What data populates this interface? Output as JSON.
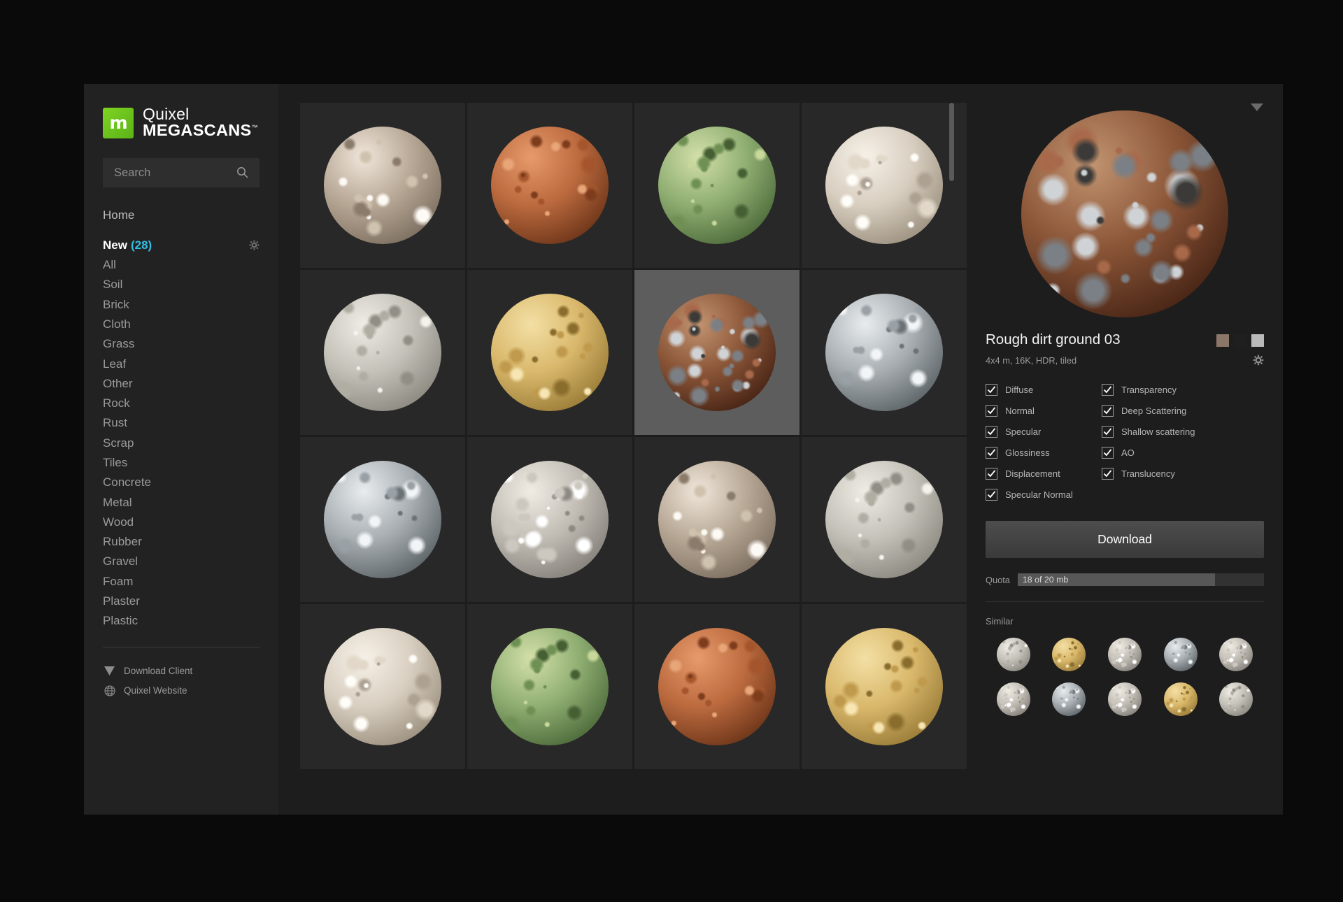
{
  "brand": {
    "name_line1": "Quixel",
    "name_line2": "MEGASCANS",
    "trademark": "™",
    "logo_letter": "m",
    "logo_color": "#7ed321"
  },
  "search": {
    "placeholder": "Search",
    "value": "",
    "icon": "search-icon"
  },
  "sidebar": {
    "home_label": "Home",
    "items": [
      {
        "label": "New",
        "count": "(28)",
        "active": true,
        "has_gear": true
      },
      {
        "label": "All",
        "active": false
      },
      {
        "label": "Soil",
        "active": false
      },
      {
        "label": "Brick",
        "active": false
      },
      {
        "label": "Cloth",
        "active": false
      },
      {
        "label": "Grass",
        "active": false
      },
      {
        "label": "Leaf",
        "active": false
      },
      {
        "label": "Other",
        "active": false
      },
      {
        "label": "Rock",
        "active": false
      },
      {
        "label": "Rust",
        "active": false
      },
      {
        "label": "Scrap",
        "active": false
      },
      {
        "label": "Tiles",
        "active": false
      },
      {
        "label": "Concrete",
        "active": false
      },
      {
        "label": "Metal",
        "active": false
      },
      {
        "label": "Wood",
        "active": false
      },
      {
        "label": "Rubber",
        "active": false
      },
      {
        "label": "Gravel",
        "active": false
      },
      {
        "label": "Foam",
        "active": false
      },
      {
        "label": "Plaster",
        "active": false
      },
      {
        "label": "Plastic",
        "active": false
      }
    ],
    "footer": [
      {
        "label": "Download Client",
        "icon": "download-triangle-icon"
      },
      {
        "label": "Quixel Website",
        "icon": "globe-icon"
      }
    ],
    "accent_color": "#35bde4"
  },
  "grid": {
    "scroll_thumb_percent": 13,
    "items": [
      {
        "name": "cracked-plaster",
        "selected": false,
        "kind": "plaster-beige"
      },
      {
        "name": "polished-copper",
        "selected": false,
        "kind": "copper"
      },
      {
        "name": "banana-leaf",
        "selected": false,
        "kind": "leaf-green"
      },
      {
        "name": "white-cloth",
        "selected": false,
        "kind": "cloth-white"
      },
      {
        "name": "scale-tiles",
        "selected": false,
        "kind": "tiles-grey"
      },
      {
        "name": "yellow-plastic",
        "selected": false,
        "kind": "plastic-yellow"
      },
      {
        "name": "rough-dirt-ground-03",
        "selected": true,
        "kind": "dirt-rock"
      },
      {
        "name": "polished-metal",
        "selected": false,
        "kind": "metal-silver"
      },
      {
        "name": "scratched-metal",
        "selected": false,
        "kind": "metal-silver"
      },
      {
        "name": "rough-gravel",
        "selected": false,
        "kind": "gravel-white"
      },
      {
        "name": "cracked-plaster-2",
        "selected": false,
        "kind": "plaster-beige"
      },
      {
        "name": "scale-tiles-2",
        "selected": false,
        "kind": "tiles-grey"
      },
      {
        "name": "white-cloth-2",
        "selected": false,
        "kind": "cloth-white"
      },
      {
        "name": "banana-leaf-2",
        "selected": false,
        "kind": "leaf-green"
      },
      {
        "name": "polished-copper-2",
        "selected": false,
        "kind": "copper"
      },
      {
        "name": "yellow-plastic-2",
        "selected": false,
        "kind": "plastic-yellow"
      }
    ]
  },
  "detail": {
    "collapse_icon": "chevron-down-icon",
    "preview_name": "rough-dirt-ground-03-preview",
    "title": "Rough dirt ground 03",
    "meta": "4x4 m, 16K, HDR, tiled",
    "swatches": [
      "#8c7668",
      "#1f1f1f",
      "#b9b9b9"
    ],
    "settings_icon": "gear-icon",
    "maps": [
      {
        "label": "Diffuse",
        "checked": true
      },
      {
        "label": "Transparency",
        "checked": true
      },
      {
        "label": "Normal",
        "checked": true
      },
      {
        "label": "Deep Scattering",
        "checked": true
      },
      {
        "label": "Specular",
        "checked": true
      },
      {
        "label": "Shallow scattering",
        "checked": true
      },
      {
        "label": "Glossiness",
        "checked": true
      },
      {
        "label": "AO",
        "checked": true
      },
      {
        "label": "Displacement",
        "checked": true
      },
      {
        "label": "Translucency",
        "checked": true
      },
      {
        "label": "Specular Normal",
        "checked": true
      }
    ],
    "download_label": "Download",
    "quota_label": "Quota",
    "quota_text": "18 of 20 mb",
    "quota_percent": 80,
    "similar_label": "Similar",
    "similar": [
      {
        "name": "similar-scale-tiles",
        "kind": "tiles-grey"
      },
      {
        "name": "similar-yellow-plastic",
        "kind": "plastic-yellow"
      },
      {
        "name": "similar-gravel",
        "kind": "gravel-white"
      },
      {
        "name": "similar-metal",
        "kind": "metal-silver"
      },
      {
        "name": "similar-gravel-2",
        "kind": "gravel-white"
      },
      {
        "name": "similar-gravel-3",
        "kind": "gravel-white"
      },
      {
        "name": "similar-metal-2",
        "kind": "metal-silver"
      },
      {
        "name": "similar-gravel-4",
        "kind": "gravel-white"
      },
      {
        "name": "similar-yellow-plastic-2",
        "kind": "plastic-yellow"
      },
      {
        "name": "similar-scale-tiles-2",
        "kind": "tiles-grey"
      }
    ]
  }
}
